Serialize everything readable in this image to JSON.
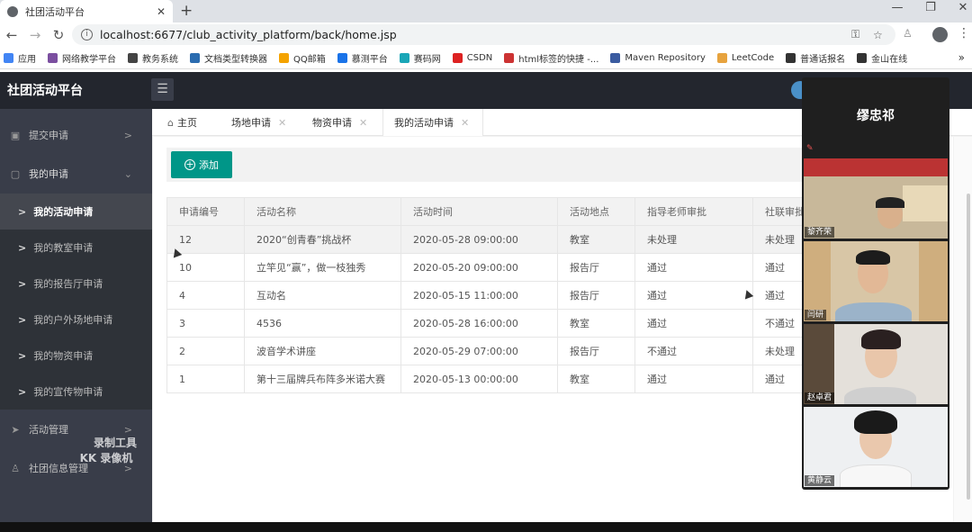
{
  "browser": {
    "tab_title": "社团活动平台",
    "url": "localhost:6677/club_activity_platform/back/home.jsp",
    "bookmarks": [
      "应用",
      "网络教学平台",
      "教务系统",
      "文档类型转换器",
      "QQ邮箱",
      "慕测平台",
      "赛码网",
      "CSDN",
      "html标签的快捷 -...",
      "Maven Repository",
      "LeetCode",
      "普通话报名",
      "金山在线"
    ],
    "more": "»"
  },
  "app": {
    "title": "社团活动平台",
    "menu_icon": "hamburger-icon"
  },
  "sidebar": {
    "items": [
      {
        "label": "提交申请"
      },
      {
        "label": "我的申请"
      },
      {
        "label": "活动管理"
      },
      {
        "label": "社团信息管理"
      }
    ],
    "sub_items": [
      {
        "label": "我的活动申请"
      },
      {
        "label": "我的教室申请"
      },
      {
        "label": "我的报告厅申请"
      },
      {
        "label": "我的户外场地申请"
      },
      {
        "label": "我的物资申请"
      },
      {
        "label": "我的宣传物申请"
      }
    ]
  },
  "page_tabs": [
    {
      "label": "主页"
    },
    {
      "label": "场地申请"
    },
    {
      "label": "物资申请"
    },
    {
      "label": "我的活动申请"
    }
  ],
  "toolbar": {
    "add_label": "添加"
  },
  "table": {
    "headers": [
      "申请编号",
      "活动名称",
      "活动时间",
      "活动地点",
      "指导老师审批",
      "社联审批"
    ],
    "rows": [
      [
        "12",
        "2020“创青春”挑战杯",
        "2020-05-28 09:00:00",
        "教室",
        "未处理",
        "未处理"
      ],
      [
        "10",
        "立竿见“赢”，做一枝独秀",
        "2020-05-20 09:00:00",
        "报告厅",
        "通过",
        "通过"
      ],
      [
        "4",
        "互动名",
        "2020-05-15 11:00:00",
        "报告厅",
        "通过",
        "通过"
      ],
      [
        "3",
        "4536",
        "2020-05-28 16:00:00",
        "教室",
        "通过",
        "不通过"
      ],
      [
        "2",
        "波音学术讲座",
        "2020-05-29 07:00:00",
        "报告厅",
        "不通过",
        "未处理"
      ],
      [
        "1",
        "第十三届牌兵布阵多米诺大赛",
        "2020-05-13 00:00:00",
        "教室",
        "通过",
        "通过"
      ]
    ]
  },
  "watermark": {
    "line1": "录制工具",
    "line2": "KK 录像机"
  },
  "meeting": {
    "host": "缪忠祁",
    "participants": [
      {
        "name": "黎齐荣"
      },
      {
        "name": "闫研"
      },
      {
        "name": "赵卓君"
      },
      {
        "name": "黄静云"
      }
    ]
  },
  "colors": {
    "accent": "#009688",
    "sidebar": "#393d49",
    "header": "#23262e"
  }
}
